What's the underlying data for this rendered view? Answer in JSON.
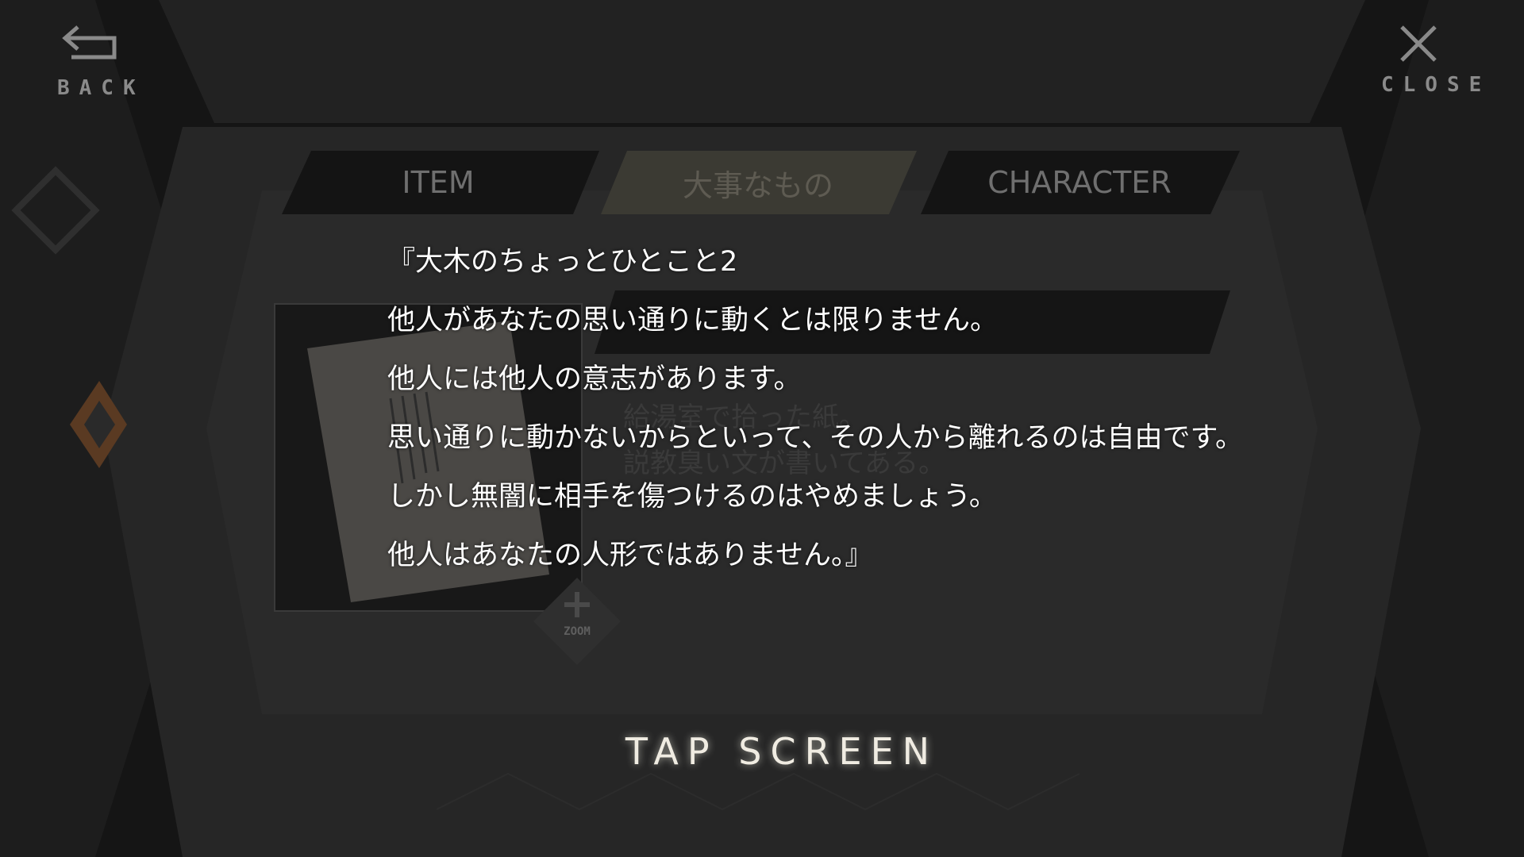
{
  "nav": {
    "back_label": "BACK",
    "close_label": "CLOSE",
    "back_icon": "back-arrow-icon",
    "close_icon": "close-x-icon"
  },
  "tabs": [
    {
      "label": "ITEM"
    },
    {
      "label": "大事なもの"
    },
    {
      "label": "CHARACTER"
    }
  ],
  "item": {
    "description": [
      "給湯室で拾った紙。",
      "説教臭い文が書いてある。"
    ],
    "zoom_label": "ZOOM"
  },
  "message": {
    "lines": [
      "『大木のちょっとひとこと2",
      "他人があなたの思い通りに動くとは限りません。",
      "他人には他人の意志があります。",
      "思い通りに動かないからといって、その人から離れるのは自由です。",
      "しかし無闇に相手を傷つけるのはやめましょう。",
      "他人はあなたの人形ではありません。』"
    ]
  },
  "prompt": {
    "tap_label": "TAP SCREEN"
  },
  "colors": {
    "overlay": "#151515",
    "accent_orange": "#c4662a",
    "text": "#ffffff"
  }
}
